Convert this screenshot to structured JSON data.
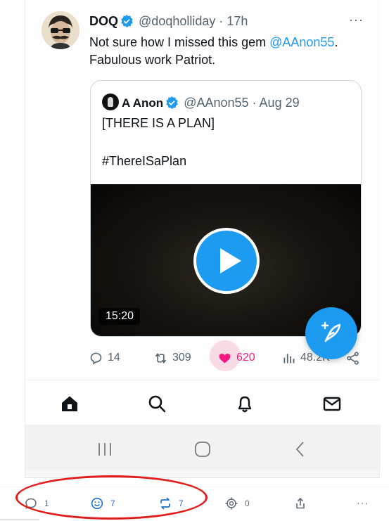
{
  "tweet": {
    "author_name": "DOQ",
    "handle": "@doqholliday",
    "separator": " · ",
    "time": "17h",
    "more": "···",
    "text_before_link": "Not sure how I missed this gem ",
    "mention": "@AAnon55",
    "text_after_link": ".",
    "text_line2": "Fabulous work Patriot."
  },
  "quote": {
    "author_name": "A Anon",
    "handle": "@AAnon55",
    "separator": " · ",
    "date": "Aug 29",
    "line1": "[THERE IS A PLAN]",
    "line2": "#ThereISaPlan",
    "video_duration": "15:20"
  },
  "actions": {
    "replies": "14",
    "reposts": "309",
    "likes": "620",
    "views": "48.2K"
  },
  "nav": [
    "home-icon",
    "search-icon",
    "bell-icon",
    "mail-icon"
  ],
  "system_nav": [
    "recents-icon",
    "home-circle-icon",
    "back-icon"
  ],
  "bottom_bar": {
    "comments": "1",
    "reactions": "7",
    "shares": "7",
    "target": "0"
  },
  "colors": {
    "accent": "#1d9bf0",
    "like": "#f91880",
    "annotation_oval": "#e21b1b"
  }
}
